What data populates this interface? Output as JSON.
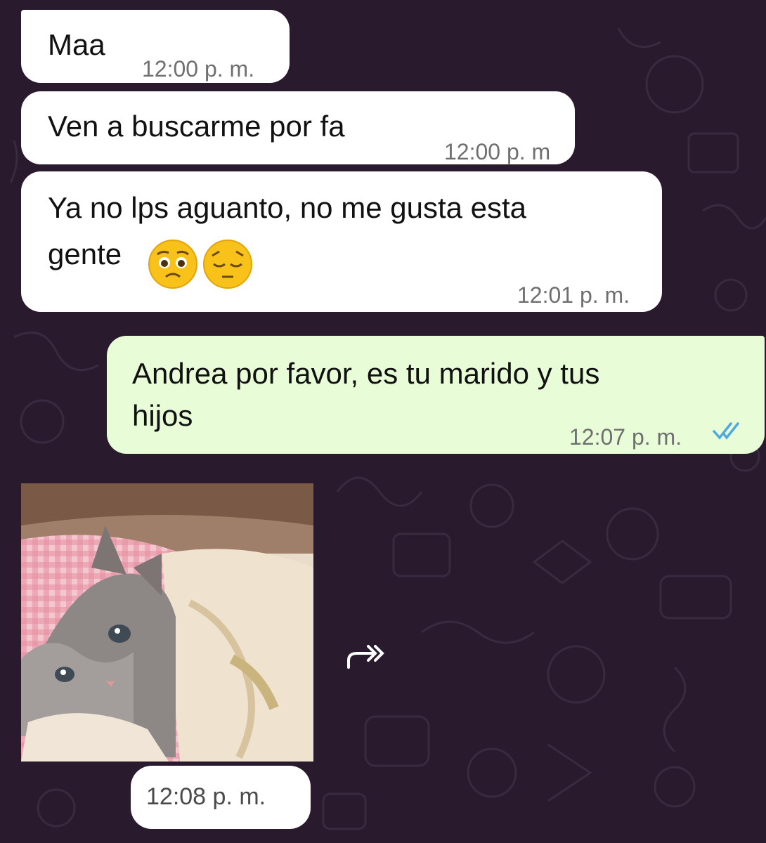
{
  "messages": [
    {
      "direction": "incoming",
      "text": "Maa",
      "time": "12:00 p. m."
    },
    {
      "direction": "incoming",
      "text": "Ven a buscarme por fa",
      "time": "12:00 p. m"
    },
    {
      "direction": "incoming",
      "line1": "Ya no lps aguanto, no me gusta esta",
      "line2": "gente",
      "emoji": [
        "pleading-face",
        "pensive-face"
      ],
      "time": "12:01 p. m."
    },
    {
      "direction": "outgoing",
      "line1": "Andrea por favor, es tu marido y tus",
      "line2": "hijos",
      "time": "12:07 p. m.",
      "status": "read-double-check-icon"
    }
  ],
  "image_message": {
    "content": "cat-under-blanket-photo",
    "time": "12:08 p. m."
  },
  "icons": {
    "forward": "forward-icon",
    "read_status": "double-check-icon"
  },
  "colors": {
    "background": "#2a1a2e",
    "incoming_bubble": "#ffffff",
    "outgoing_bubble": "#e7fcd7",
    "read_check": "#4fa9e0",
    "timestamp": "#6f6f6f"
  }
}
